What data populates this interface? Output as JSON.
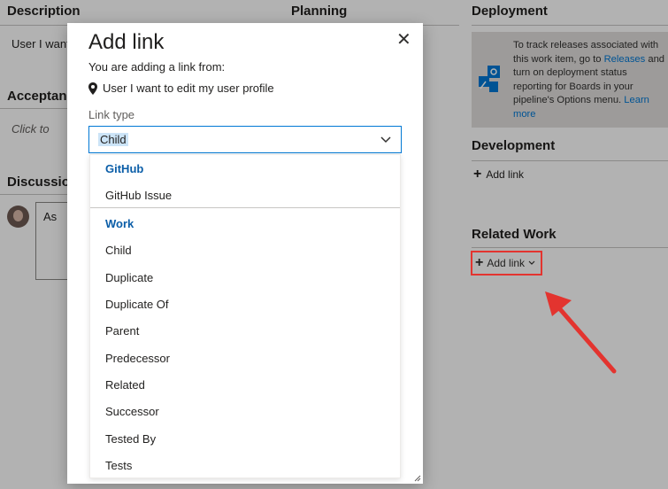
{
  "background": {
    "description_title": "Description",
    "planning_title": "Planning",
    "deployment_title": "Deployment",
    "description_value": "User I want",
    "acceptance_title": "Acceptan",
    "acceptance_placeholder": "Click to",
    "discussion_title": "Discussion",
    "comment_prefix": "As",
    "deployment_text_1": "To track releases associated with this work item, go to",
    "deployment_link_1": "Releases",
    "deployment_text_2": "and turn on deployment status reporting for Boards in your pipeline's Options menu.",
    "deployment_link_2": "Learn more",
    "development_title": "Development",
    "development_add_link": "Add link",
    "related_work_title": "Related Work",
    "related_add_link": "Add link"
  },
  "dialog": {
    "title": "Add link",
    "subtitle": "You are adding a link from:",
    "source_item": "User I want to edit my user profile",
    "link_type_label": "Link type",
    "selected_value": "Child"
  },
  "dropdown": {
    "groups": [
      {
        "header": "GitHub",
        "items": [
          "GitHub Issue"
        ]
      },
      {
        "header": "Work",
        "items": [
          "Child",
          "Duplicate",
          "Duplicate Of",
          "Parent",
          "Predecessor",
          "Related",
          "Successor",
          "Tested By",
          "Tests"
        ]
      }
    ]
  },
  "colors": {
    "accent": "#0078d4",
    "highlight_red": "#e3342f",
    "group_header": "#0b5ea8"
  }
}
